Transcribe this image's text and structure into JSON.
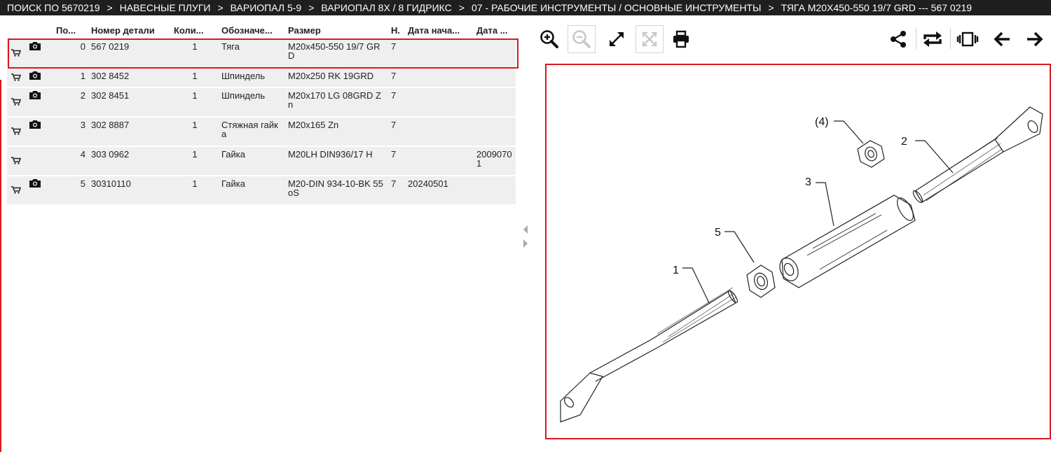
{
  "breadcrumb": [
    "ПОИСК ПО 5670219",
    "НАВЕСНЫЕ ПЛУГИ",
    "ВАРИОПАЛ 5-9",
    "ВАРИОПАЛ 8X / 8 ГИДРИКС",
    "07 - РАБОЧИЕ ИНСТРУМЕНТЫ / ОСНОВНЫЕ ИНСТРУМЕНТЫ",
    "ТЯГА M20X450-550 19/7 GRD --- 567 0219"
  ],
  "breadcrumb_separator": ">",
  "table": {
    "headers": {
      "pos": "По...",
      "part_no": "Номер детали",
      "qty": "Коли...",
      "name": "Обозначе...",
      "size": "Размер",
      "n": "Н.",
      "date_start": "Дата нача...",
      "date_end": "Дата ..."
    },
    "rows": [
      {
        "pos": "0",
        "part_no": "567 0219",
        "qty": "1",
        "name": "Тяга",
        "size": "M20x450-550 19/7 GRD",
        "n": "7",
        "date_start": "",
        "date_end": "",
        "has_photo": true
      },
      {
        "pos": "1",
        "part_no": "302 8452",
        "qty": "1",
        "name": "Шпиндель",
        "size": "M20x250 RK 19GRD",
        "n": "7",
        "date_start": "",
        "date_end": "",
        "has_photo": true
      },
      {
        "pos": "2",
        "part_no": "302 8451",
        "qty": "1",
        "name": "Шпиндель",
        "size": "M20x170 LG 08GRD Zn",
        "n": "7",
        "date_start": "",
        "date_end": "",
        "has_photo": true
      },
      {
        "pos": "3",
        "part_no": "302 8887",
        "qty": "1",
        "name": "Стяжная гайка",
        "size": "M20x165 Zn",
        "n": "7",
        "date_start": "",
        "date_end": "",
        "has_photo": true
      },
      {
        "pos": "4",
        "part_no": "303 0962",
        "qty": "1",
        "name": "Гайка",
        "size": "M20LH DIN936/17 H",
        "n": "7",
        "date_start": "",
        "date_end": "20090701",
        "has_photo": false
      },
      {
        "pos": "5",
        "part_no": "30310110",
        "qty": "1",
        "name": "Гайка",
        "size": "M20-DIN 934-10-BK 55oS",
        "n": "7",
        "date_start": "20240501",
        "date_end": "",
        "has_photo": true
      }
    ]
  },
  "diagram": {
    "callouts": {
      "c1": "1",
      "c2": "2",
      "c3": "3",
      "c4": "(4)",
      "c5": "5"
    }
  },
  "toolbar": {
    "icons": [
      "zoom-in-icon",
      "zoom-out-icon",
      "expand-icon",
      "fit-icon",
      "print-icon",
      "share-icon",
      "repeat-icon",
      "carousel-icon",
      "arrow-left-icon",
      "arrow-right-icon"
    ],
    "zoom_out_disabled": true,
    "fit_disabled": true
  },
  "colors": {
    "accent": "#d71920",
    "topbar": "#1f1f1f",
    "row_bg": "#efefef"
  }
}
